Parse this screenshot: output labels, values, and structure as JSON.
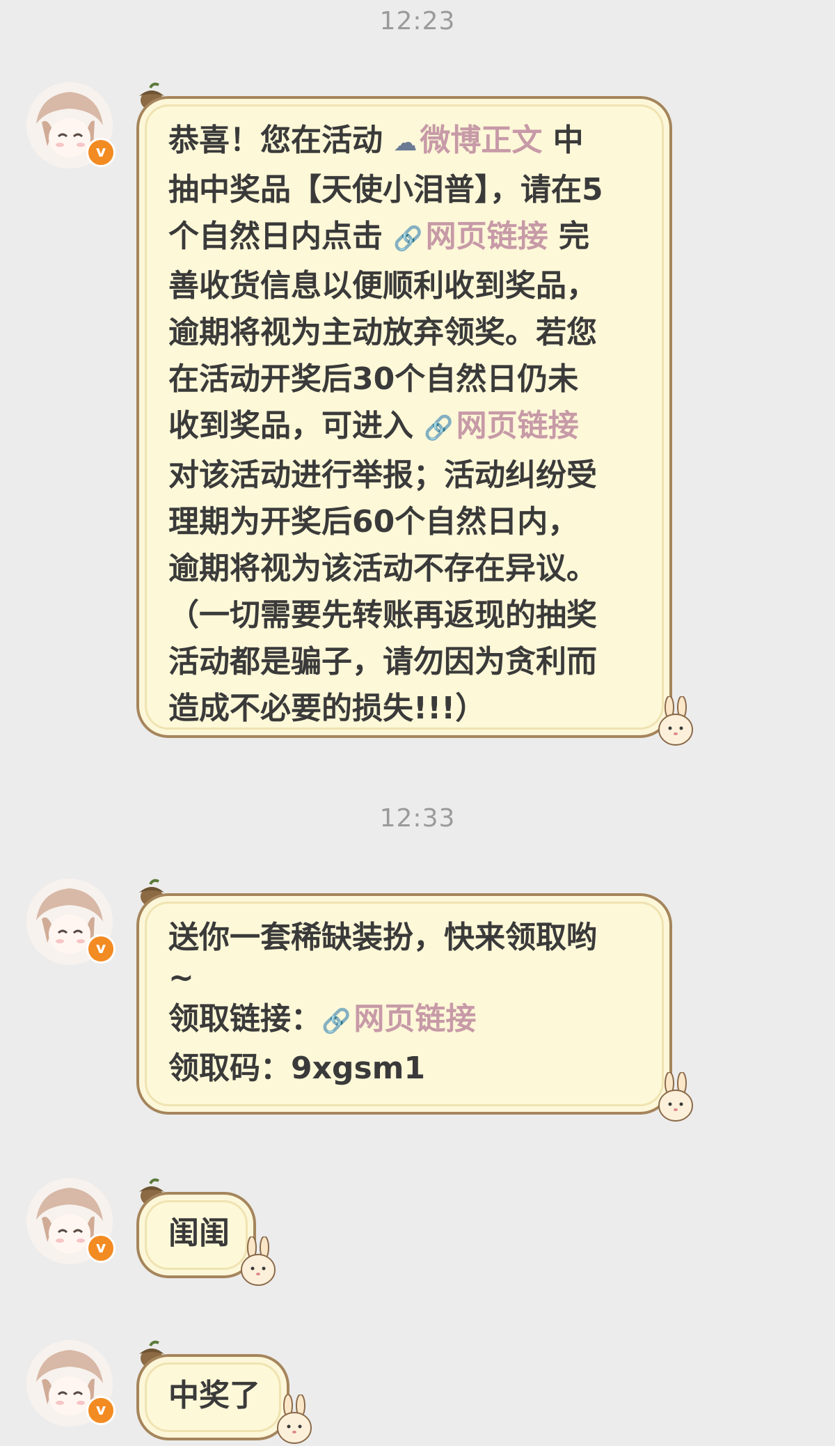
{
  "timestamps": {
    "first": "12:23",
    "second": "12:33"
  },
  "messages": {
    "m1": {
      "line1_a": "恭喜！您在活动",
      "line1_link": "微博正文",
      "line1_b": "中",
      "line2": "抽中奖品【天使小泪普】，请在5",
      "line3_a": "个自然日内点击",
      "line3_link": "网页链接",
      "line3_b": "完",
      "line4": "善收货信息以便顺利收到奖品，",
      "line5": "逾期将视为主动放弃领奖。若您",
      "line6": "在活动开奖后30个自然日仍未",
      "line7_a": "收到奖品，可进入",
      "line7_link": "网页链接",
      "line8": "对该活动进行举报；活动纠纷受",
      "line9": "理期为开奖后60个自然日内，",
      "line10": "逾期将视为该活动不存在异议。",
      "line11": "（一切需要先转账再返现的抽奖",
      "line12": "活动都是骗子，请勿因为贪利而",
      "line13": "造成不必要的损失!!!）"
    },
    "m2": {
      "line1": "送你一套稀缺装扮，快来领取哟",
      "line2": "~",
      "line3_a": "领取链接：",
      "line3_link": "网页链接",
      "line4": "领取码：9xgsm1"
    },
    "m3": {
      "text": "闺闺"
    },
    "m4": {
      "text": "中奖了"
    }
  },
  "icons": {
    "weibo_link": "cloud-icon",
    "web_link": "link-chain-icon",
    "verified": "verified-v-badge",
    "badge_letter": "v",
    "bubble_decor_top": "acorn-icon",
    "bubble_decor_bottom": "bunny-icon"
  },
  "colors": {
    "background": "#ececec",
    "bubble_fill": "#fdf8d8",
    "bubble_border": "#a5855c",
    "link_text": "#c79aa7",
    "timestamp": "#9a9a9a",
    "badge": "#f28b22"
  }
}
